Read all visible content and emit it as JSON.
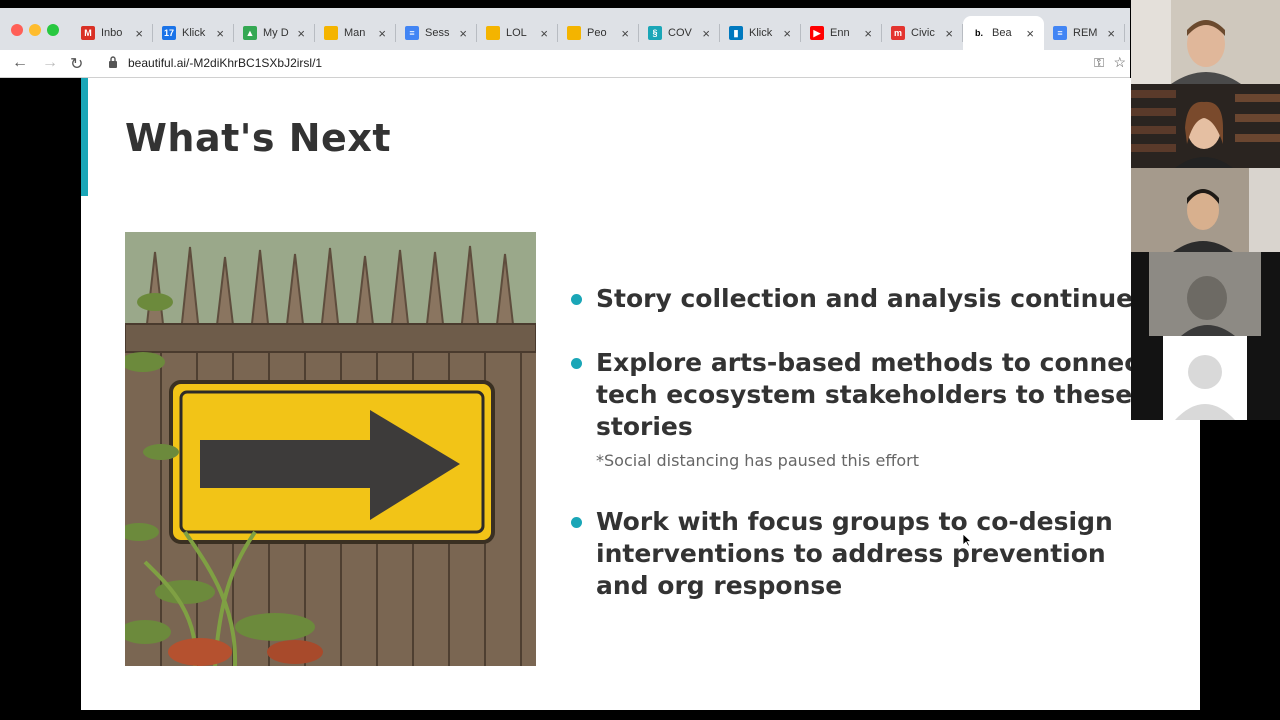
{
  "browser": {
    "tabs": [
      {
        "label": "Inbo",
        "favicon": "gmail-icon",
        "color": "#d93025",
        "glyph": "M"
      },
      {
        "label": "Klick",
        "favicon": "calendar-icon",
        "color": "#1a73e8",
        "glyph": "17"
      },
      {
        "label": "My D",
        "favicon": "drive-icon",
        "color": "#34a853",
        "glyph": "▲"
      },
      {
        "label": "Man",
        "favicon": "slides-icon",
        "color": "#f4b400",
        "glyph": ""
      },
      {
        "label": "Sess",
        "favicon": "docs-icon",
        "color": "#4285f4",
        "glyph": "≡"
      },
      {
        "label": "LOL",
        "favicon": "slides-icon",
        "color": "#f4b400",
        "glyph": ""
      },
      {
        "label": "Peo",
        "favicon": "slides-icon",
        "color": "#f4b400",
        "glyph": ""
      },
      {
        "label": "COV",
        "favicon": "link-icon",
        "color": "#1aa6b7",
        "glyph": "§"
      },
      {
        "label": "Klick",
        "favicon": "trello-icon",
        "color": "#0079bf",
        "glyph": "▮"
      },
      {
        "label": "Enn",
        "favicon": "youtube-icon",
        "color": "#ff0000",
        "glyph": "▶"
      },
      {
        "label": "Civic",
        "favicon": "miro-icon",
        "color": "#e3342f",
        "glyph": "m"
      },
      {
        "label": "Bea",
        "favicon": "beautiful-ai-icon",
        "color": "#ffffff",
        "glyph": "b.",
        "active": true
      },
      {
        "label": "REM",
        "favicon": "docs-icon",
        "color": "#4285f4",
        "glyph": "≡"
      }
    ],
    "url": "beautiful.ai/-M2diKhrBC1SXbJ2irsl/1"
  },
  "slide": {
    "title": "What's Next",
    "bullets": [
      {
        "text": "Story collection and analysis continues"
      },
      {
        "text": "Explore arts-based methods to connect tech ecosystem stakeholders to these stories",
        "note": "*Social distancing has paused this effort"
      },
      {
        "text": "Work with focus groups to co-design interventions to address prevention and org response"
      }
    ],
    "accent_color": "#1aa6b7"
  },
  "video_tiles": [
    {
      "kind": "camera"
    },
    {
      "kind": "camera"
    },
    {
      "kind": "camera"
    },
    {
      "kind": "camera"
    },
    {
      "kind": "avatar-placeholder"
    }
  ]
}
